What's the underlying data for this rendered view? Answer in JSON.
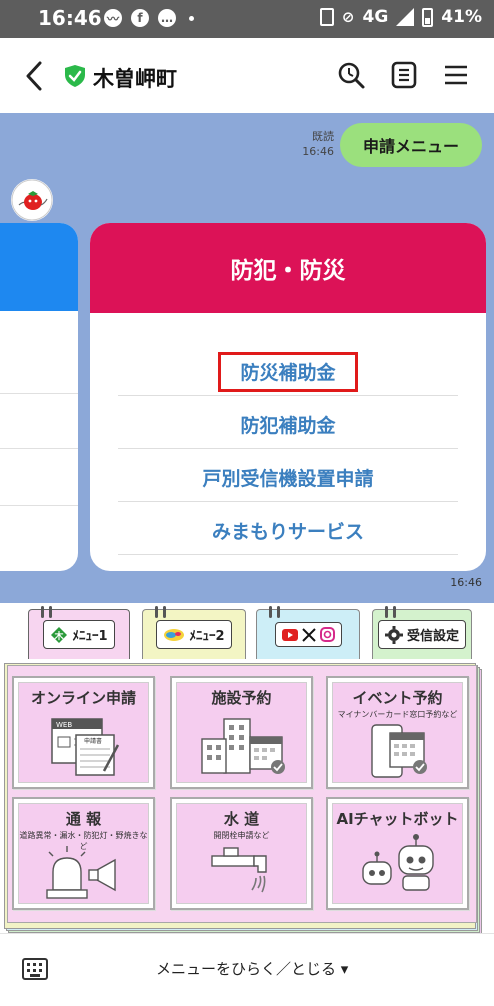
{
  "status_bar": {
    "time": "16:46",
    "network": "4G",
    "battery": "41%",
    "left_icons": [
      "messenger-icon",
      "facebook-icon",
      "chat-bubble-icon"
    ],
    "right_icons": [
      "nfc-icon",
      "vibrate-off-icon",
      "signal-icon",
      "battery-icon"
    ]
  },
  "header": {
    "title": "木曽岬町",
    "icons": [
      "back-icon",
      "verified-shield-icon",
      "search-icon",
      "note-icon",
      "menu-icon"
    ]
  },
  "chat": {
    "outgoing": {
      "text": "申請メニュー",
      "read_label": "既読",
      "time": "16:46"
    },
    "card": {
      "title": "防犯・防災",
      "items": [
        "防災補助金",
        "防犯補助金",
        "戸別受信機設置申請",
        "みまもりサービス"
      ],
      "highlighted_item": "防災補助金"
    },
    "incoming_time": "16:46"
  },
  "rich_menu": {
    "tabs": [
      {
        "label": "ﾒﾆｭｰ1"
      },
      {
        "label": "ﾒﾆｭｰ2"
      },
      {
        "label": ""
      },
      {
        "label": "受信設定"
      }
    ],
    "tiles": [
      {
        "title": "オンライン申請",
        "subtitle": ""
      },
      {
        "title": "施設予約",
        "subtitle": ""
      },
      {
        "title": "イベント予約",
        "subtitle": "マイナンバーカード窓口予約など"
      },
      {
        "title": "通 報",
        "subtitle": "道路異常・漏水・防犯灯・野焼きなど"
      },
      {
        "title": "水 道",
        "subtitle": "開閉栓申請など"
      },
      {
        "title": "AIチャットボット",
        "subtitle": ""
      }
    ],
    "icon_labels": {
      "web_label": "WEB",
      "form_label": "申請書"
    },
    "colors": {
      "panel": "#f7d5f0",
      "tile": "#f5cdef",
      "tab2": "#f3f5c4",
      "tab3": "#cdeef7",
      "tab4": "#d4f2cd"
    }
  },
  "bottom_bar": {
    "toggle_label": "メニューをひらく／とじる ▾"
  },
  "colors": {
    "chat_bg": "#8ca8d8",
    "bubble": "#9be07d",
    "card_header": "#dc1257",
    "card_link": "#3b7fbf",
    "highlight": "#e01a1a"
  }
}
